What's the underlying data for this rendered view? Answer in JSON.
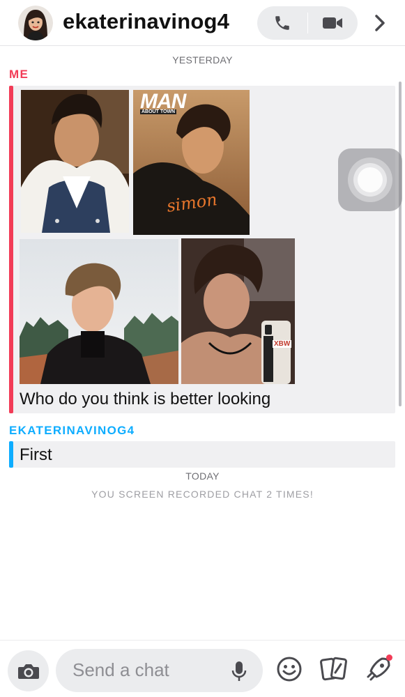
{
  "header": {
    "username": "ekaterinavinog4",
    "icons": [
      "avatar",
      "phone-icon",
      "video-icon",
      "chevron-right-icon"
    ]
  },
  "chat": {
    "yesterday_label": "YESTERDAY",
    "me_label": "ME",
    "me_message": "Who do you think is better looking",
    "other_label": "EKATERINAVINOG4",
    "other_message": "First",
    "today_label": "TODAY",
    "screen_record_notice": "YOU SCREEN RECORDED CHAT 2 TIMES!",
    "photo1_caption": "MAN",
    "photo1_subcaption": "ABOUT TOWN",
    "photo1_signature": "simon",
    "photo4_case_text": "XBW"
  },
  "bottom_bar": {
    "input_placeholder": "Send a chat",
    "icons": [
      "camera-icon",
      "mic-icon",
      "smiley-icon",
      "cards-icon",
      "rocket-icon"
    ]
  },
  "colors": {
    "me_accent": "#f23c57",
    "other_accent": "#0eadff",
    "bubble_bg": "#f0f0f2"
  }
}
